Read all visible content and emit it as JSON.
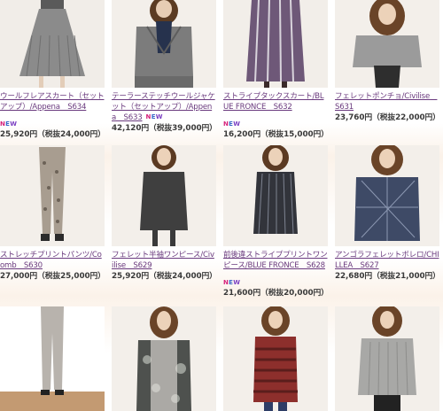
{
  "products": [
    {
      "name": "ウールフレアスカート（セットアップ）/Appena　S634",
      "new": true,
      "new_inline": false,
      "price": "25,920円（税抜24,000円）"
    },
    {
      "name": "テーラーステッチウールジャケット（セットアップ）/Appena　S633",
      "new": true,
      "new_inline": true,
      "price": "42,120円（税抜39,000円）"
    },
    {
      "name": "ストライプタックスカート/BLUE FRONCE　S632",
      "new": true,
      "new_inline": false,
      "price": "16,200円（税抜15,000円）"
    },
    {
      "name": "フェレットポンチョ/Civilise　S631",
      "new": true,
      "new_inline": false,
      "price": "23,760円（税抜22,000円）"
    },
    {
      "name": "ストレッチプリントパンツ/Coomb　S630",
      "new": true,
      "new_inline": false,
      "price": "27,000円（税抜25,000円）"
    },
    {
      "name": "フェレット半袖ワンピース/Civilise　S629",
      "new": false,
      "new_inline": false,
      "price": "25,920円（税抜24,000円）"
    },
    {
      "name": "前後違ストライププリントワンピース/BLUE FRONCE　S628",
      "new": true,
      "new_inline": false,
      "price": "21,600円（税抜20,000円）"
    },
    {
      "name": "アンゴラフェレットボレロ/CHILLEA　S627",
      "new": true,
      "new_inline": false,
      "price": "22,680円（税抜21,000円）"
    },
    {
      "name": "",
      "new": false,
      "new_inline": false,
      "price": ""
    },
    {
      "name": "",
      "new": false,
      "new_inline": false,
      "price": ""
    },
    {
      "name": "",
      "new": false,
      "new_inline": false,
      "price": ""
    },
    {
      "name": "",
      "new": false,
      "new_inline": false,
      "price": ""
    }
  ],
  "new_badge": {
    "n": "N",
    "e": "E",
    "w": "W"
  },
  "colors": {
    "link": "#6a3a7e",
    "new_n": "#d6217a",
    "new_e": "#3a68c9",
    "new_w": "#7a3ec2",
    "price": "#3a3a3a"
  }
}
